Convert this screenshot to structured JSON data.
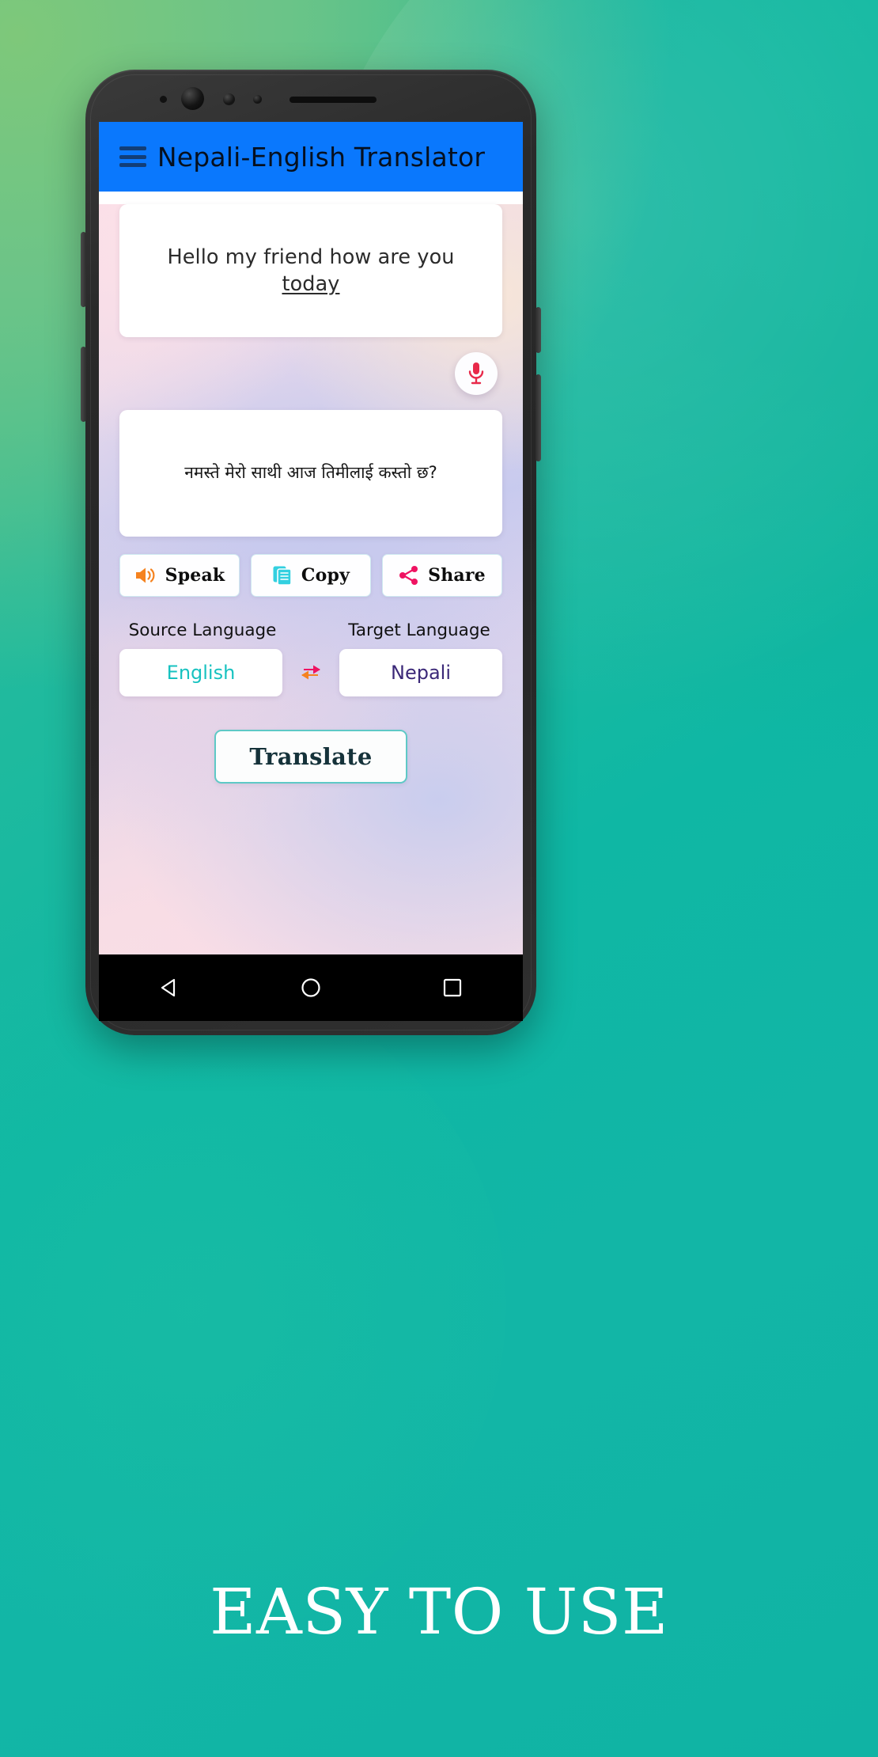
{
  "app": {
    "title": "Nepali-English Translator",
    "menu_icon": "hamburger-menu-icon"
  },
  "input": {
    "text_before": "Hello my friend how are you ",
    "text_underlined": "today",
    "full_text": "Hello my friend how are you today"
  },
  "mic": {
    "icon": "microphone-icon"
  },
  "output": {
    "text": "नमस्ते मेरो साथी आज तिमीलाई कस्तो छ?"
  },
  "actions": [
    {
      "label": "Speak",
      "icon": "speaker-volume-icon",
      "color": "#f5821f"
    },
    {
      "label": "Copy",
      "icon": "copy-pages-icon",
      "color": "#33d0e0"
    },
    {
      "label": "Share",
      "icon": "share-nodes-icon",
      "color": "#ef1362"
    }
  ],
  "languages": {
    "source_label": "Source Language",
    "target_label": "Target Language",
    "source_value": "English",
    "target_value": "Nepali",
    "swap_icon": "swap-arrows-icon",
    "source_color": "#17c2c0",
    "target_color": "#3b2878"
  },
  "translate": {
    "label": "Translate",
    "border_color": "#5ec9c6"
  },
  "navbar": {
    "back": "back-triangle-icon",
    "home": "home-circle-icon",
    "recents": "recents-square-icon"
  },
  "caption": {
    "text": "EASY TO USE"
  },
  "theme": {
    "appbar_color": "#0a78fd",
    "page_bg_start": "#63c47e",
    "page_bg_end": "#10b3a4"
  }
}
